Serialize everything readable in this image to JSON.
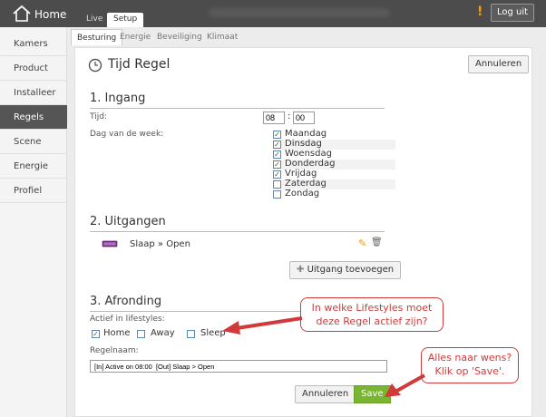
{
  "app": {
    "logo_label": "Home"
  },
  "top_tabs": [
    "Live",
    "Setup"
  ],
  "topbar": {
    "logout": "Log uit",
    "alert": "!"
  },
  "sidebar": {
    "items": [
      "Kamers",
      "Product",
      "Installeer",
      "Regels",
      "Scene",
      "Energie",
      "Profiel"
    ],
    "active": "Regels"
  },
  "sub_tabs": [
    "Besturing",
    "Energie",
    "Beveiliging",
    "Klimaat"
  ],
  "page": {
    "title": "Tijd Regel",
    "cancel_top": "Annuleren"
  },
  "ingang": {
    "heading": "1. Ingang",
    "time_label": "Tijd:",
    "hour": "08",
    "minute": "00",
    "days_label": "Dag van de week:",
    "days": [
      {
        "name": "Maandag",
        "checked": true
      },
      {
        "name": "Dinsdag",
        "checked": true
      },
      {
        "name": "Woensdag",
        "checked": true
      },
      {
        "name": "Donderdag",
        "checked": true
      },
      {
        "name": "Vrijdag",
        "checked": true
      },
      {
        "name": "Zaterdag",
        "checked": false
      },
      {
        "name": "Zondag",
        "checked": false
      }
    ]
  },
  "uitgangen": {
    "heading": "2. Uitgangen",
    "item": "Slaap » Open",
    "add_button": "Uitgang toevoegen"
  },
  "afronding": {
    "heading": "3. Afronding",
    "lifestyles_label": "Actief in lifestyles:",
    "lifestyles": [
      {
        "name": "Home",
        "checked": true
      },
      {
        "name": "Away",
        "checked": false
      },
      {
        "name": "Sleep",
        "checked": false
      }
    ],
    "rule_name_label": "Regelnaam:",
    "rule_name_value": "[In] Active on 08:00  [Out] Slaap > Open",
    "cancel": "Annuleren",
    "save": "Save"
  },
  "callouts": {
    "lifestyles": [
      "In welke Lifestyles moet",
      "deze Regel actief zijn?"
    ],
    "save": [
      "Alles naar wens?",
      "Klik op 'Save'."
    ]
  },
  "colors": {
    "save_green": "#7ab531",
    "callout_red": "#d03a3a"
  }
}
